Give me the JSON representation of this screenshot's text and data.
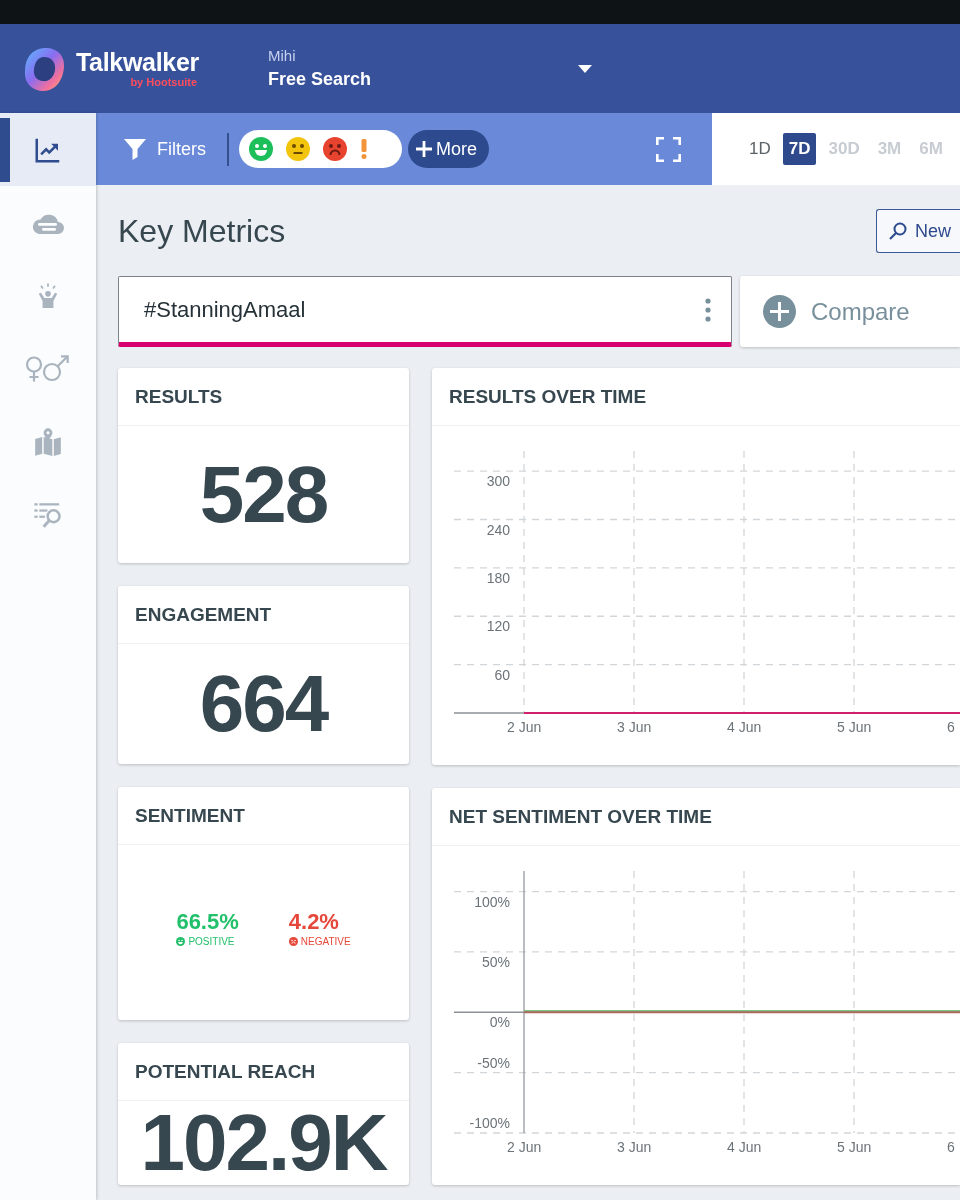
{
  "header": {
    "brand": "Talkwalker",
    "brand_tagline": "by Hootsuite",
    "workspace": "Mihi",
    "search_name": "Free Search"
  },
  "sidebar": {
    "items": [
      {
        "kind": "trend",
        "selected": true
      },
      {
        "kind": "cloud",
        "selected": false
      },
      {
        "kind": "cheer",
        "selected": false
      },
      {
        "kind": "gender",
        "selected": false
      },
      {
        "kind": "map",
        "selected": false
      },
      {
        "kind": "list-search",
        "selected": false
      }
    ]
  },
  "filter_bar": {
    "filters_label": "Filters",
    "sentiment_filters": [
      {
        "kind": "positive",
        "color": "#1dbf5b"
      },
      {
        "kind": "neutral",
        "color": "#f2c40c"
      },
      {
        "kind": "negative",
        "color": "#e8432f"
      },
      {
        "kind": "alert",
        "color": "#f4943a"
      }
    ],
    "more_label": "More"
  },
  "periods": [
    {
      "label": "1D",
      "selected": false,
      "disabled": false
    },
    {
      "label": "7D",
      "selected": true,
      "disabled": false
    },
    {
      "label": "30D",
      "selected": false,
      "disabled": true
    },
    {
      "label": "3M",
      "selected": false,
      "disabled": true
    },
    {
      "label": "6M",
      "selected": false,
      "disabled": true
    }
  ],
  "page": {
    "title": "Key Metrics",
    "new_button": "New"
  },
  "queries": [
    {
      "label": "#StanningAmaal",
      "color": "#d6006e"
    }
  ],
  "compare_label": "Compare",
  "left_cards": [
    {
      "kind": "metric",
      "title": "RESULTS",
      "value": "528"
    },
    {
      "kind": "metric",
      "title": "ENGAGEMENT",
      "value": "664"
    },
    {
      "kind": "sentiment",
      "title": "SENTIMENT",
      "items": [
        {
          "kind": "positive",
          "value": "66.5%",
          "label": "POSITIVE",
          "color": "#22c06a"
        },
        {
          "kind": "negative",
          "value": "4.2%",
          "label": "NEGATIVE",
          "color": "#e5483a"
        }
      ]
    },
    {
      "kind": "metric",
      "title": "POTENTIAL REACH",
      "value": "102.9K"
    }
  ],
  "right_cards": [
    {
      "kind": "chart",
      "title": "RESULTS OVER TIME",
      "chart_data": {
        "type": "line",
        "categories": [
          "2 Jun",
          "3 Jun",
          "4 Jun",
          "5 Jun",
          "6"
        ],
        "series": [
          {
            "color": "#d0206e",
            "values": [
              0,
              0,
              0,
              0,
              0
            ]
          }
        ],
        "ylim": [
          0,
          325
        ],
        "yticks": [
          60,
          120,
          180,
          240,
          300
        ],
        "grid": true
      }
    },
    {
      "kind": "chart",
      "title": "NET SENTIMENT OVER TIME",
      "chart_data": {
        "type": "line",
        "categories": [
          "2 Jun",
          "3 Jun",
          "4 Jun",
          "5 Jun",
          "6"
        ],
        "series": [
          {
            "color": "#7cc47f",
            "values": [
              1,
              1,
              1,
              1,
              1
            ]
          },
          {
            "color": "#a86a5c",
            "values": [
              0,
              0,
              0,
              0,
              0
            ]
          }
        ],
        "ylim": [
          -100,
          117
        ],
        "yticks": [
          {
            "value": 100,
            "label": "100%"
          },
          {
            "value": 50,
            "label": "50%"
          },
          {
            "value": 0,
            "label": "0%"
          },
          {
            "value": -50,
            "label": "-50%"
          },
          {
            "value": -100,
            "label": "-100%"
          }
        ],
        "grid": true
      }
    }
  ]
}
